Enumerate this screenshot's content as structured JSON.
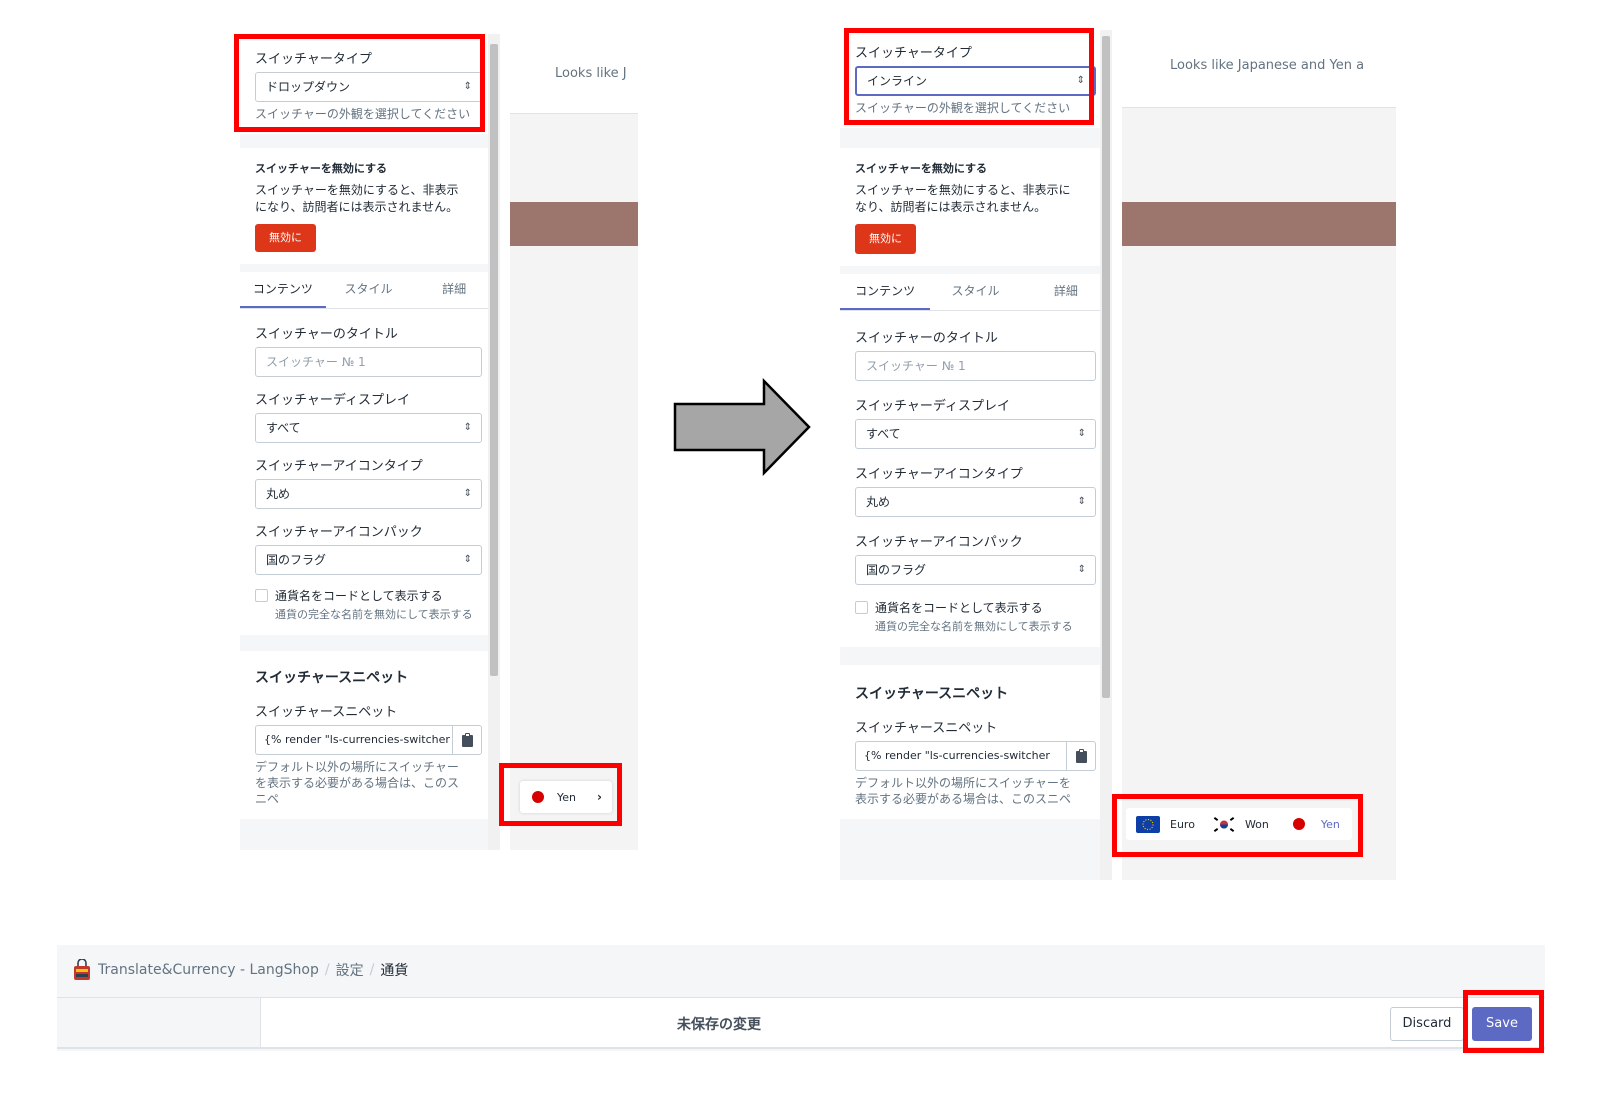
{
  "editor": {
    "switcher_type": {
      "label": "スイッチャータイプ",
      "help": "スイッチャーの外観を選択してください"
    },
    "disable": {
      "title": "スイッチャーを無効にする",
      "description": "スイッチャーを無効にすると、非表示になり、訪問者には表示されません。",
      "button": "無効に"
    },
    "tabs": [
      "コンテンツ",
      "スタイル",
      "詳細"
    ],
    "switcher_title": {
      "label": "スイッチャーのタイトル",
      "placeholder": "スイッチャー № 1"
    },
    "switcher_display": {
      "label": "スイッチャーディスプレイ",
      "value": "すべて"
    },
    "icon_type": {
      "label": "スイッチャーアイコンタイプ",
      "value": "丸め"
    },
    "icon_pack": {
      "label": "スイッチャーアイコンパック",
      "value": "国のフラグ"
    },
    "code_checkbox": {
      "label": "通貨名をコードとして表示する",
      "help": "通貨の完全な名前を無効にして表示する"
    },
    "snippet": {
      "heading": "スイッチャースニペット",
      "label": "スイッチャースニペット",
      "value": "{% render \"ls-currencies-switcher",
      "help": "デフォルト以外の場所にスイッチャーを表示する必要がある場合は、このスニペ"
    }
  },
  "before": {
    "switcher_type_value": "ドロップダウン",
    "preview_text": "Looks like J",
    "switcher": {
      "currency": "Yen"
    }
  },
  "after": {
    "switcher_type_value": "インライン",
    "preview_text": "Looks like Japanese and Yen a",
    "switcher": {
      "currencies": [
        "Euro",
        "Won",
        "Yen"
      ],
      "active": "Yen"
    }
  },
  "app_bar": {
    "breadcrumb": [
      "Translate&Currency - LangShop",
      "設定",
      "通貨"
    ],
    "unsaved_text": "未保存の変更",
    "discard_label": "Discard",
    "save_label": "Save"
  },
  "colors": {
    "highlight": "#ff0000",
    "accent": "#5c6ac4",
    "danger": "#de3618",
    "preview_band": "#9c756c"
  },
  "icons": [
    "select-arrows-icon",
    "clipboard-icon",
    "chevron-right-icon",
    "japan-flag-icon",
    "eu-flag-icon",
    "korea-flag-icon",
    "arrow-right-icon",
    "langshop-logo-icon"
  ]
}
